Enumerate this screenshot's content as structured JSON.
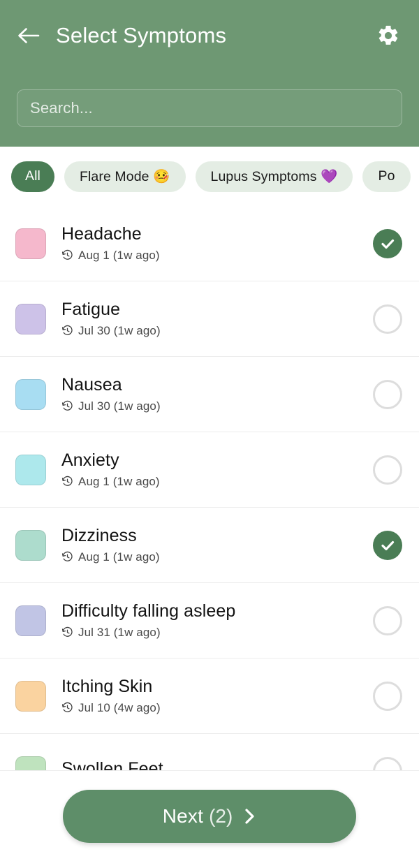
{
  "header": {
    "title": "Select Symptoms",
    "back_icon": "arrow-left-icon",
    "settings_icon": "gear-icon",
    "background_color": "#6E9873"
  },
  "search": {
    "value": "",
    "placeholder": "Search..."
  },
  "filters": {
    "chips": [
      {
        "label": "All",
        "active": true
      },
      {
        "label": "Flare Mode 🤒",
        "active": false
      },
      {
        "label": "Lupus Symptoms 💜",
        "active": false
      },
      {
        "label": "Po",
        "active": false
      }
    ],
    "active_color": "#4A7D55",
    "inactive_color": "#E4EDE4"
  },
  "list": {
    "rows": [
      {
        "name": "Headache",
        "date": "Aug 1 (1w ago)",
        "swatch": "#F5B8CC",
        "selected": true
      },
      {
        "name": "Fatigue",
        "date": "Jul 30 (1w ago)",
        "swatch": "#CDC2E8",
        "selected": false
      },
      {
        "name": "Nausea",
        "date": "Jul 30 (1w ago)",
        "swatch": "#A8DDF2",
        "selected": false
      },
      {
        "name": "Anxiety",
        "date": "Aug 1 (1w ago)",
        "swatch": "#ADE8EC",
        "selected": false
      },
      {
        "name": "Dizziness",
        "date": "Aug 1 (1w ago)",
        "swatch": "#ADDCCD",
        "selected": true
      },
      {
        "name": "Difficulty falling asleep",
        "date": "Jul 31 (1w ago)",
        "swatch": "#C1C5E5",
        "selected": false
      },
      {
        "name": "Itching Skin",
        "date": "Jul 10 (4w ago)",
        "swatch": "#FAD3A0",
        "selected": false
      },
      {
        "name": "Swollen Feet",
        "date": "",
        "swatch": "#BFE3BE",
        "selected": false
      }
    ],
    "history_icon": "clock-history-icon",
    "checked_color": "#4A7D55",
    "unchecked_border_color": "#DDDDDD"
  },
  "bottom": {
    "next_label": "Next",
    "next_count": "(2)",
    "chevron_icon": "chevron-right-icon",
    "button_color": "#5E8E69"
  }
}
